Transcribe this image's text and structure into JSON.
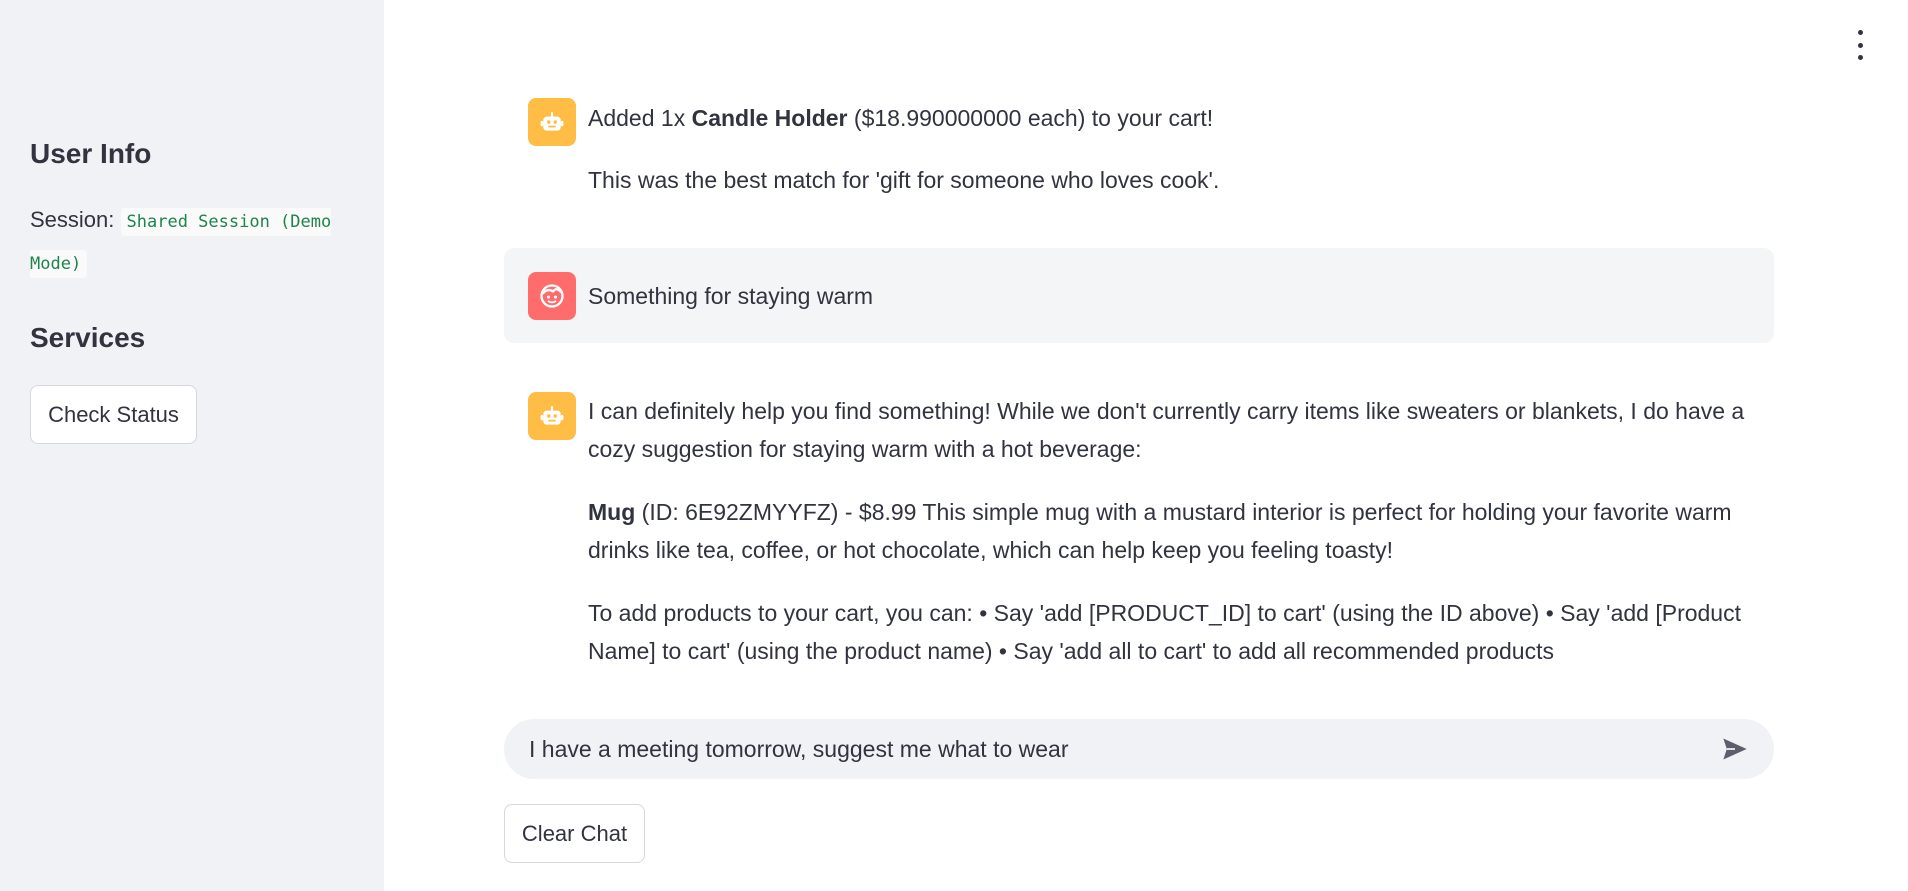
{
  "sidebar": {
    "user_info_heading": "User Info",
    "session_label": "Session:",
    "session_value": "Shared Session (Demo Mode)",
    "services_heading": "Services",
    "check_status_label": "Check Status"
  },
  "messages": [
    {
      "role": "assistant",
      "icon": "robot-icon",
      "line1_prefix": "Added 1x ",
      "line1_bold": "Candle Holder",
      "line1_suffix": " ($18.990000000 each) to your cart!",
      "line2": "This was the best match for 'gift for someone who loves cook'."
    },
    {
      "role": "user",
      "icon": "user-face-icon",
      "text": "Something for staying warm"
    },
    {
      "role": "assistant",
      "icon": "robot-icon",
      "p1": "I can definitely help you find something! While we don't currently carry items like sweaters or blankets, I do have a cozy suggestion for staying warm with a hot beverage:",
      "p2_bold": "Mug",
      "p2_rest": " (ID: 6E92ZMYYFZ) - $8.99 This simple mug with a mustard interior is perfect for holding your favorite warm drinks like tea, coffee, or hot chocolate, which can help keep you feeling toasty!",
      "p3": "To add products to your cart, you can: • Say 'add [PRODUCT_ID] to cart' (using the ID above) • Say 'add [Product Name] to cart' (using the product name) • Say 'add all to cart' to add all recommended products"
    }
  ],
  "chat_input": {
    "value": "I have a meeting tomorrow, suggest me what to wear"
  },
  "clear_chat_label": "Clear Chat",
  "colors": {
    "bot_avatar": "#ffbd45",
    "user_avatar": "#ff6c6c",
    "sidebar_bg": "#f0f2f6"
  }
}
